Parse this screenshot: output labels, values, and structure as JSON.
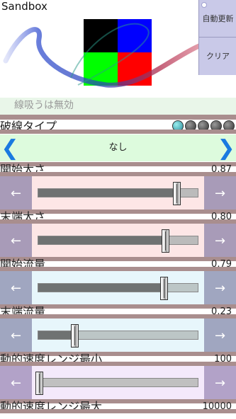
{
  "app": {
    "title": "Sandbox"
  },
  "side_buttons": {
    "auto_update": "自動更新",
    "clear": "クリア"
  },
  "cut_label": "線吸うは無効",
  "dash_type": {
    "label": "破線タイプ",
    "value": "なし",
    "dots": [
      true,
      false,
      false,
      false,
      false
    ],
    "prev_icon": "chevron-left-icon",
    "next_icon": "chevron-right-icon"
  },
  "sliders": [
    {
      "id": "start-size",
      "label": "開始太さ",
      "value": "0.87",
      "fraction": 0.87
    },
    {
      "id": "end-size",
      "label": "末端太さ",
      "value": "0.80",
      "fraction": 0.8
    },
    {
      "id": "start-flow",
      "label": "開始流量",
      "value": "0.79",
      "fraction": 0.79
    },
    {
      "id": "end-flow",
      "label": "末端流量",
      "value": "0.23",
      "fraction": 0.23
    },
    {
      "id": "speed-min",
      "label": "動的速度レンジ最小",
      "value": "100",
      "fraction": 0.01
    },
    {
      "id": "speed-max",
      "label": "動的速度レンジ最大",
      "value": "10000",
      "fraction": null
    }
  ],
  "arrows": {
    "left": "←",
    "right": "→"
  },
  "colors": {
    "accent_blue": "#1a7ae0",
    "tile_black": "#000000",
    "tile_blue": "#0000ff",
    "tile_green": "#00ff00",
    "tile_red": "#ff0000",
    "side_button_bg": "#c9c9e8",
    "dash_panel_bg": "#ddfbdd"
  }
}
